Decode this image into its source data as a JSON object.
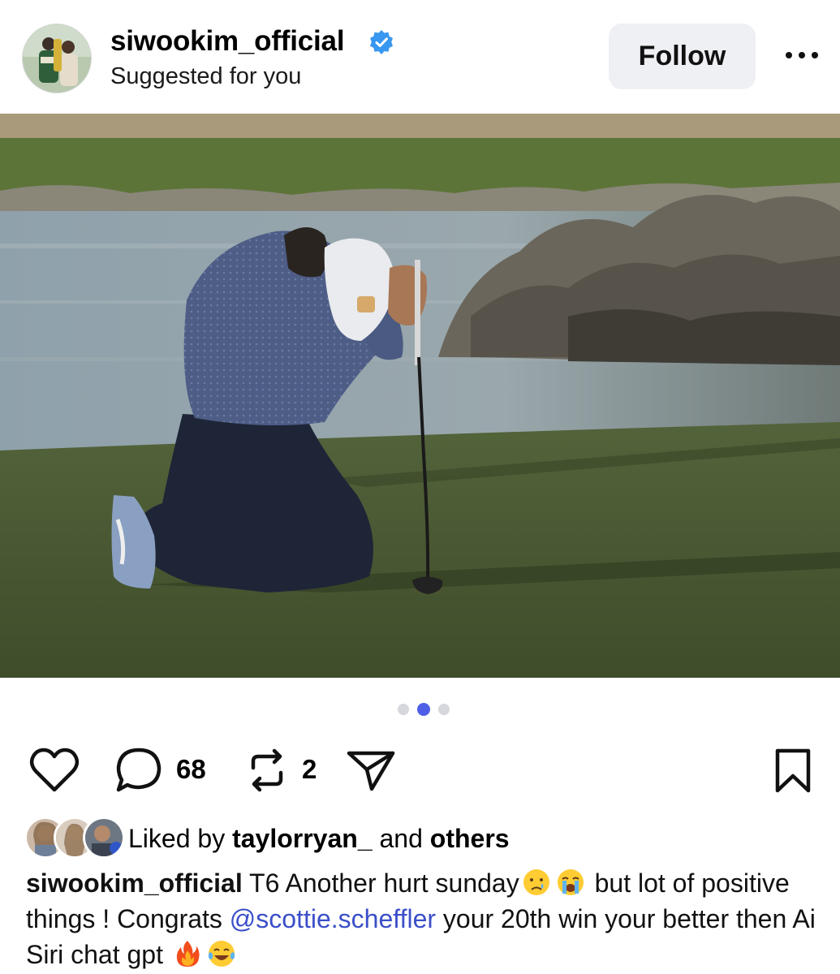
{
  "post": {
    "username": "siwookim_official",
    "subtitle": "Suggested for you",
    "follow_label": "Follow",
    "image_count": 3,
    "active_image_index": 1
  },
  "actions": {
    "comments_count": "68",
    "reposts_count": "2"
  },
  "likes": {
    "prefix": "Liked by",
    "user": "taylorryan_",
    "middle": "and",
    "suffix": "others"
  },
  "caption": {
    "username": "siwookim_official",
    "text_1": "T6 Another hurt sunday",
    "text_2": "but lot of positive things ! Congrats",
    "mention": "@scottie.scheffler",
    "text_3": "your 20th win your better then Ai Siri chat gpt"
  },
  "colors": {
    "accent_blue": "#4f5fe8",
    "mention_blue": "#3b4fc9",
    "verified_blue": "#3897f0",
    "follow_bg": "#eff0f3"
  },
  "icons": {
    "verified": "verified-badge-icon",
    "more": "more-horizontal-icon",
    "like": "heart-icon",
    "comment": "comment-icon",
    "repost": "repost-icon",
    "share": "send-icon",
    "save": "bookmark-icon"
  }
}
